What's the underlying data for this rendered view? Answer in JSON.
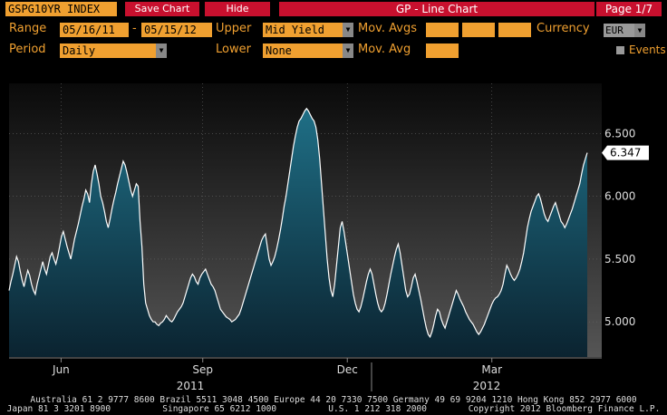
{
  "header": {
    "ticker": "GSPG10YR INDEX",
    "save_chart": "Save Chart",
    "hide": "Hide",
    "title": "GP - Line Chart",
    "page": "Page 1/7"
  },
  "controls": {
    "range_label": "Range",
    "range_start": "05/16/11",
    "range_sep": "-",
    "range_end": "05/15/12",
    "upper_label": "Upper",
    "upper_value": "Mid Yield",
    "mov_avgs_label": "Mov. Avgs",
    "currency_label": "Currency",
    "currency_value": "EUR",
    "period_label": "Period",
    "period_value": "Daily",
    "lower_label": "Lower",
    "lower_value": "None",
    "mov_avg_label": "Mov. Avg",
    "events_label": "Events"
  },
  "colors": {
    "accent": "#f0a030",
    "bar_red": "#c8102e",
    "line": "#ffffff",
    "fill_top": "#1f6f86",
    "fill_bottom": "#0b2330"
  },
  "chart_data": {
    "type": "area",
    "ylim": [
      4.72,
      6.9
    ],
    "y_ticks": [
      5.0,
      5.5,
      6.0,
      6.5
    ],
    "y_tick_labels": [
      "5.000",
      "5.500",
      "6.000",
      "6.500"
    ],
    "x_month_labels": [
      "Jun",
      "Sep",
      "Dec",
      "Mar"
    ],
    "x_year_labels": [
      "2011",
      "2012"
    ],
    "last_value_label": "6.347",
    "grid": true,
    "series": [
      {
        "values": [
          5.25,
          5.32,
          5.38,
          5.45,
          5.52,
          5.48,
          5.4,
          5.33,
          5.28,
          5.35,
          5.41,
          5.37,
          5.3,
          5.25,
          5.22,
          5.3,
          5.36,
          5.42,
          5.48,
          5.42,
          5.38,
          5.45,
          5.52,
          5.55,
          5.5,
          5.46,
          5.52,
          5.6,
          5.68,
          5.72,
          5.66,
          5.6,
          5.55,
          5.5,
          5.58,
          5.66,
          5.72,
          5.78,
          5.85,
          5.92,
          5.98,
          6.05,
          6.02,
          5.95,
          6.1,
          6.2,
          6.25,
          6.18,
          6.1,
          6.0,
          5.95,
          5.88,
          5.8,
          5.75,
          5.82,
          5.9,
          5.97,
          6.03,
          6.1,
          6.16,
          6.22,
          6.28,
          6.25,
          6.19,
          6.12,
          6.05,
          6.0,
          6.05,
          6.1,
          6.08,
          5.8,
          5.6,
          5.3,
          5.15,
          5.1,
          5.05,
          5.02,
          5.0,
          5.0,
          4.98,
          4.97,
          4.99,
          5.0,
          5.02,
          5.05,
          5.03,
          5.01,
          5.0,
          5.02,
          5.05,
          5.08,
          5.1,
          5.12,
          5.15,
          5.2,
          5.25,
          5.3,
          5.35,
          5.38,
          5.36,
          5.32,
          5.3,
          5.35,
          5.38,
          5.4,
          5.42,
          5.38,
          5.34,
          5.3,
          5.28,
          5.25,
          5.2,
          5.15,
          5.1,
          5.08,
          5.06,
          5.04,
          5.03,
          5.02,
          5.0,
          5.01,
          5.02,
          5.04,
          5.06,
          5.1,
          5.15,
          5.2,
          5.25,
          5.3,
          5.35,
          5.4,
          5.45,
          5.5,
          5.55,
          5.6,
          5.65,
          5.68,
          5.7,
          5.6,
          5.5,
          5.45,
          5.48,
          5.52,
          5.58,
          5.65,
          5.73,
          5.82,
          5.92,
          6.0,
          6.1,
          6.2,
          6.3,
          6.4,
          6.48,
          6.55,
          6.6,
          6.62,
          6.65,
          6.68,
          6.7,
          6.68,
          6.65,
          6.62,
          6.6,
          6.55,
          6.45,
          6.3,
          6.1,
          5.9,
          5.7,
          5.5,
          5.35,
          5.25,
          5.2,
          5.3,
          5.45,
          5.6,
          5.75,
          5.8,
          5.72,
          5.62,
          5.52,
          5.42,
          5.32,
          5.22,
          5.15,
          5.1,
          5.08,
          5.12,
          5.18,
          5.25,
          5.32,
          5.38,
          5.42,
          5.38,
          5.3,
          5.22,
          5.15,
          5.1,
          5.08,
          5.1,
          5.15,
          5.22,
          5.3,
          5.38,
          5.45,
          5.52,
          5.58,
          5.62,
          5.55,
          5.45,
          5.35,
          5.25,
          5.2,
          5.22,
          5.28,
          5.35,
          5.38,
          5.32,
          5.25,
          5.18,
          5.1,
          5.02,
          4.95,
          4.9,
          4.88,
          4.92,
          4.98,
          5.05,
          5.1,
          5.08,
          5.02,
          4.98,
          4.95,
          5.0,
          5.05,
          5.1,
          5.15,
          5.2,
          5.25,
          5.22,
          5.18,
          5.15,
          5.12,
          5.08,
          5.05,
          5.02,
          5.0,
          4.98,
          4.95,
          4.92,
          4.9,
          4.92,
          4.95,
          4.98,
          5.02,
          5.06,
          5.1,
          5.14,
          5.17,
          5.19,
          5.2,
          5.22,
          5.25,
          5.3,
          5.38,
          5.45,
          5.42,
          5.38,
          5.35,
          5.33,
          5.35,
          5.38,
          5.42,
          5.48,
          5.55,
          5.65,
          5.75,
          5.82,
          5.88,
          5.92,
          5.96,
          6.0,
          6.02,
          5.98,
          5.92,
          5.86,
          5.82,
          5.8,
          5.84,
          5.88,
          5.92,
          5.95,
          5.9,
          5.85,
          5.8,
          5.78,
          5.75,
          5.78,
          5.82,
          5.86,
          5.9,
          5.95,
          6.0,
          6.05,
          6.1,
          6.18,
          6.25,
          6.3,
          6.347
        ]
      }
    ]
  },
  "footer": {
    "line1": "Australia 61 2 9777 8600 Brazil 5511 3048 4500 Europe 44 20 7330 7500 Germany 49 69 9204 1210 Hong Kong 852 2977 6000",
    "line2": "Japan 81 3 3201 8900          Singapore 65 6212 1000          U.S. 1 212 318 2000        Copyright 2012 Bloomberg Finance L.P."
  }
}
